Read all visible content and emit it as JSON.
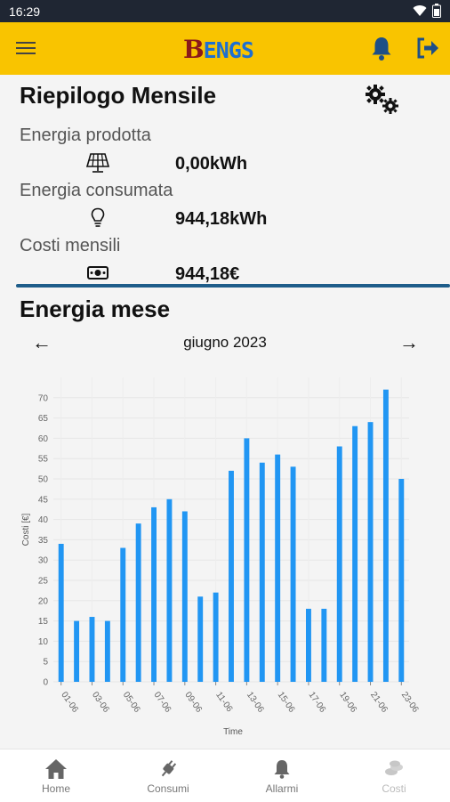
{
  "status_bar": {
    "time": "16:29"
  },
  "app_bar": {
    "logo_first": "B",
    "logo_rest": "ENGS"
  },
  "summary": {
    "title": "Riepilogo Mensile",
    "metrics": [
      {
        "label": "Energia prodotta",
        "value": "0,00kWh",
        "icon": "solar-panel-icon"
      },
      {
        "label": "Energia consumata",
        "value": "944,18kWh",
        "icon": "lightbulb-icon"
      },
      {
        "label": "Costi mensili",
        "value": "944,18€",
        "icon": "money-icon"
      }
    ]
  },
  "energy": {
    "title": "Energia mese",
    "month": "giugno 2023",
    "prev_icon": "←",
    "next_icon": "→"
  },
  "chart_data": {
    "type": "bar",
    "ylabel": "Costi [€]",
    "xlabel": "Time",
    "ylim": [
      0,
      75
    ],
    "yticks": [
      0,
      5,
      10,
      15,
      20,
      25,
      30,
      35,
      40,
      45,
      50,
      55,
      60,
      65,
      70
    ],
    "xtick_labels": [
      "01-06",
      "03-06",
      "05-06",
      "07-06",
      "09-06",
      "11-06",
      "13-06",
      "15-06",
      "17-06",
      "19-06",
      "21-06",
      "23-06"
    ],
    "categories": [
      "01-06",
      "02-06",
      "03-06",
      "04-06",
      "05-06",
      "06-06",
      "07-06",
      "08-06",
      "09-06",
      "10-06",
      "11-06",
      "12-06",
      "13-06",
      "14-06",
      "15-06",
      "16-06",
      "17-06",
      "18-06",
      "19-06",
      "20-06",
      "21-06",
      "22-06",
      "23-06"
    ],
    "values": [
      34,
      15,
      16,
      15,
      33,
      39,
      43,
      45,
      42,
      21,
      22,
      52,
      60,
      54,
      56,
      53,
      18,
      18,
      58,
      63,
      64,
      72,
      50
    ],
    "color": "#2196f3",
    "grid": true
  },
  "bottom_nav": {
    "items": [
      {
        "label": "Home",
        "icon": "home-icon"
      },
      {
        "label": "Consumi",
        "icon": "plug-icon"
      },
      {
        "label": "Allarmi",
        "icon": "bell-icon"
      },
      {
        "label": "Costi",
        "icon": "coins-icon"
      }
    ]
  }
}
